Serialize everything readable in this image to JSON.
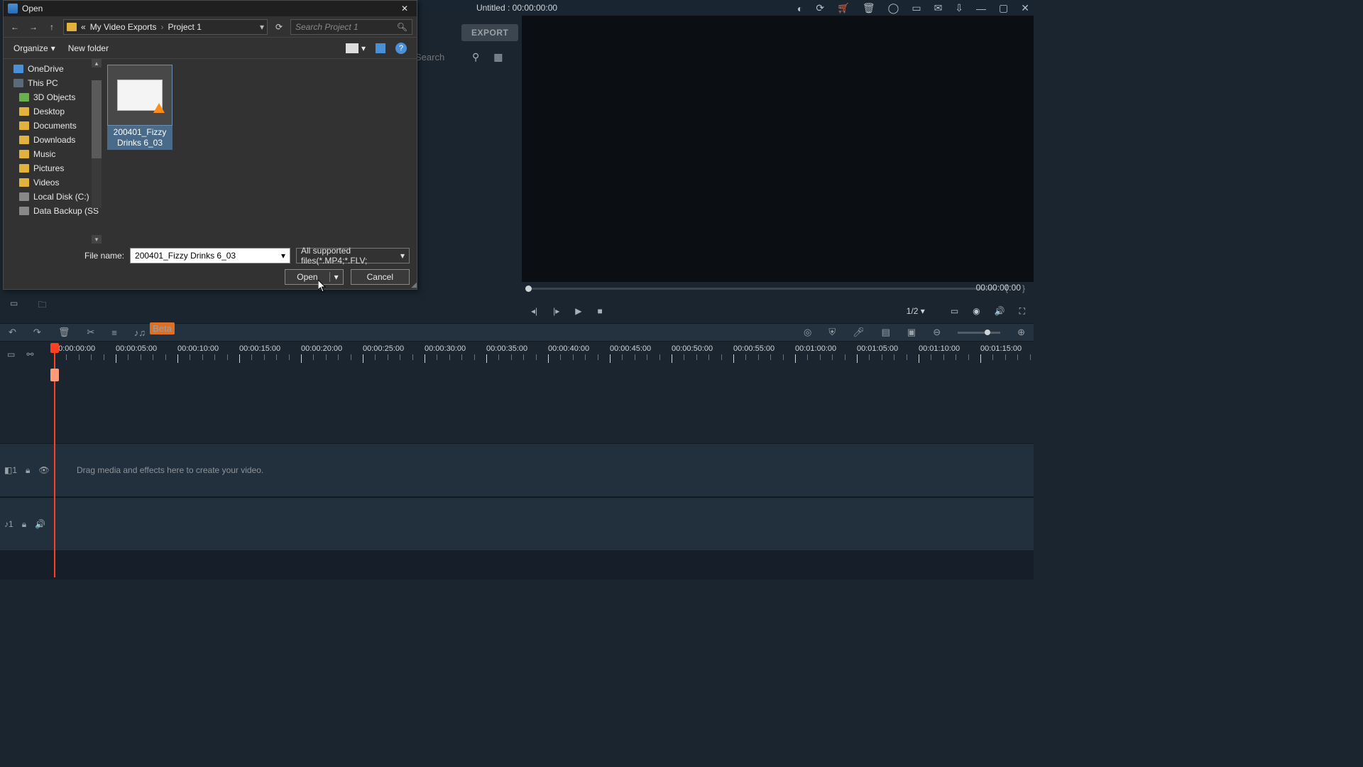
{
  "app": {
    "title": "Untitled : 00:00:00:00",
    "export_label": "EXPORT",
    "search_placeholder": "Search"
  },
  "titlebar_icons": [
    "bulb",
    "sync",
    "cart",
    "trash",
    "user",
    "note",
    "mail",
    "download",
    "min",
    "max",
    "close"
  ],
  "preview": {
    "time": "00:00:00:00",
    "ratio": "1/2"
  },
  "toolrow": {
    "beta": "Beta"
  },
  "timeline": {
    "ticks": [
      "00:00:00:00",
      "00:00:05:00",
      "00:00:10:00",
      "00:00:15:00",
      "00:00:20:00",
      "00:00:25:00",
      "00:00:30:00",
      "00:00:35:00",
      "00:00:40:00",
      "00:00:45:00",
      "00:00:50:00",
      "00:00:55:00",
      "00:01:00:00",
      "00:01:05:00",
      "00:01:10:00",
      "00:01:15:00"
    ],
    "track1_label": "1",
    "track2_label": "1",
    "hint": "Drag media and effects here to create your video."
  },
  "dialog": {
    "title": "Open",
    "breadcrumb_prefix": "«",
    "breadcrumb_1": "My Video Exports",
    "breadcrumb_2": "Project 1",
    "search_placeholder": "Search Project 1",
    "organize": "Organize",
    "new_folder": "New folder",
    "tree": [
      {
        "label": "OneDrive",
        "root": true,
        "ico": "ico-cloud"
      },
      {
        "label": "This PC",
        "root": true,
        "ico": "ico-pc"
      },
      {
        "label": "3D Objects",
        "root": false,
        "ico": "ico-3d"
      },
      {
        "label": "Desktop",
        "root": false,
        "ico": "ico-folder"
      },
      {
        "label": "Documents",
        "root": false,
        "ico": "ico-folder"
      },
      {
        "label": "Downloads",
        "root": false,
        "ico": "ico-folder"
      },
      {
        "label": "Music",
        "root": false,
        "ico": "ico-folder"
      },
      {
        "label": "Pictures",
        "root": false,
        "ico": "ico-folder"
      },
      {
        "label": "Videos",
        "root": false,
        "ico": "ico-folder"
      },
      {
        "label": "Local Disk (C:)",
        "root": false,
        "ico": "ico-drive"
      },
      {
        "label": "Data Backup (SS",
        "root": false,
        "ico": "ico-drive"
      }
    ],
    "file_label_l1": "200401_Fizzy",
    "file_label_l2": "Drinks 6_03",
    "filename_label": "File name:",
    "filename_value": "200401_Fizzy Drinks 6_03",
    "filter_value": "All supported files(*.MP4;*.FLV;",
    "open_btn": "Open",
    "cancel_btn": "Cancel"
  }
}
